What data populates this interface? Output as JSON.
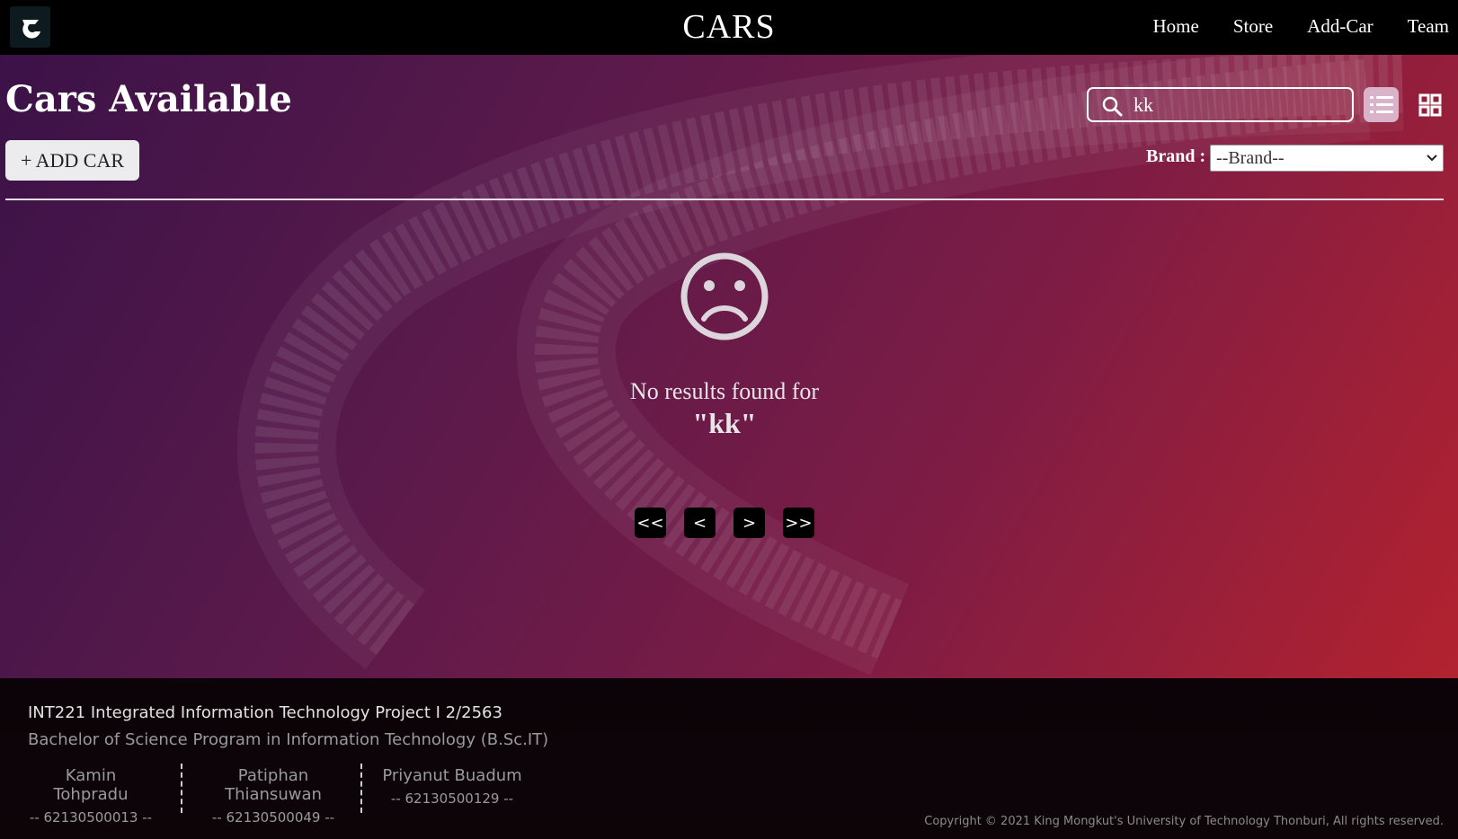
{
  "navbar": {
    "brand": "CARS",
    "links": [
      "Home",
      "Store",
      "Add-Car",
      "Team"
    ]
  },
  "main": {
    "title": "Cars Available",
    "add_car_label": "+ ADD CAR",
    "search": {
      "value": "kk",
      "placeholder": ""
    },
    "brand_label": "Brand :",
    "brand_select_value": "--Brand--",
    "empty_state": {
      "message": "No results found for",
      "query": "\"kk\""
    },
    "pagination": {
      "first": "<<",
      "prev": "<",
      "next": ">",
      "last": ">>"
    }
  },
  "footer": {
    "course": "INT221 Integrated Information Technology Project I 2/2563",
    "program": "Bachelor of Science Program in Information Technology (B.Sc.IT)",
    "members": [
      {
        "name": "Kamin Tohpradu",
        "id": "-- 62130500013 --"
      },
      {
        "name": "Patiphan Thiansuwan",
        "id": "-- 62130500049 --"
      },
      {
        "name": "Priyanut Buadum",
        "id": "-- 62130500129 --"
      }
    ],
    "copyright": "Copyright © 2021 King Mongkut's University of Technology Thonburi, All rights reserved."
  },
  "colors": {
    "accent_gradient_start": "#3b1248",
    "accent_gradient_end": "#b3222f",
    "navbar": "#000000",
    "footer": "#0b0307"
  },
  "icons": [
    "logo-icon",
    "search-icon",
    "list-view-icon",
    "grid-view-icon",
    "sad-face-icon",
    "chevron-down-icon"
  ]
}
